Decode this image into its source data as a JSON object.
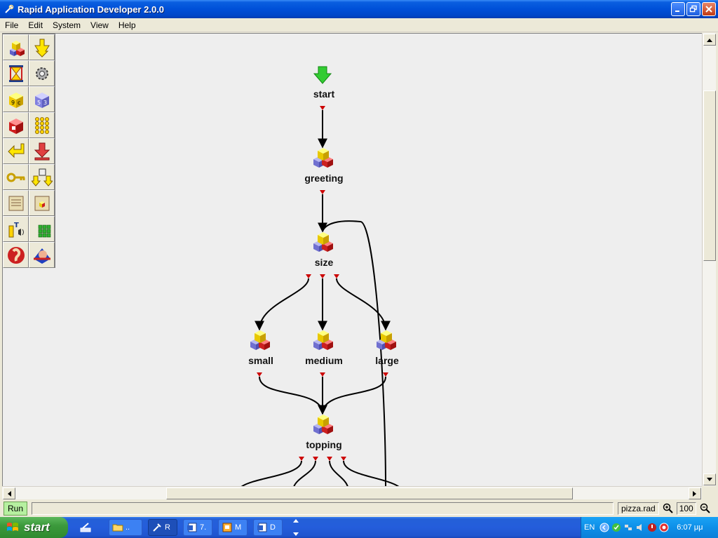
{
  "window": {
    "title": "Rapid Application Developer 2.0.0"
  },
  "menu": [
    "File",
    "Edit",
    "System",
    "View",
    "Help"
  ],
  "palette": [
    "generic-subdialog-icon",
    "branch-icon",
    "hourglass-icon",
    "gear-icon",
    "alpha-digits-icon",
    "digits-icon",
    "prompt-icon",
    "keypad-icon",
    "return-icon",
    "exit-icon",
    "key-icon",
    "download-icon",
    "scroll-icon",
    "scroll-subdialog-icon",
    "tts-icon",
    "grid-icon",
    "ear-icon",
    "face-icon"
  ],
  "flow": {
    "nodes": [
      {
        "id": "start",
        "label": "start"
      },
      {
        "id": "greeting",
        "label": "greeting"
      },
      {
        "id": "size",
        "label": "size"
      },
      {
        "id": "small",
        "label": "small"
      },
      {
        "id": "medium",
        "label": "medium"
      },
      {
        "id": "large",
        "label": "large"
      },
      {
        "id": "topping",
        "label": "topping"
      }
    ]
  },
  "status": {
    "run_label": "Run",
    "filename": "pizza.rad",
    "zoom": "100"
  },
  "taskbar": {
    "start_label": "start",
    "tasks": [
      {
        "label": "..",
        "icon": "folder-icon"
      },
      {
        "label": "R",
        "icon": "rad-app-icon"
      },
      {
        "label": "7.",
        "icon": "word-doc-icon"
      },
      {
        "label": "M",
        "icon": "presentation-icon"
      },
      {
        "label": "D",
        "icon": "word-doc-icon"
      }
    ],
    "language": "EN",
    "clock": "6:07 μμ"
  },
  "colors": {
    "titlebar": "#0050d8",
    "canvas": "#eeeeee",
    "start_arrow": "#33cc33",
    "port": "#cc0000",
    "taskbar": "#245ddb"
  }
}
